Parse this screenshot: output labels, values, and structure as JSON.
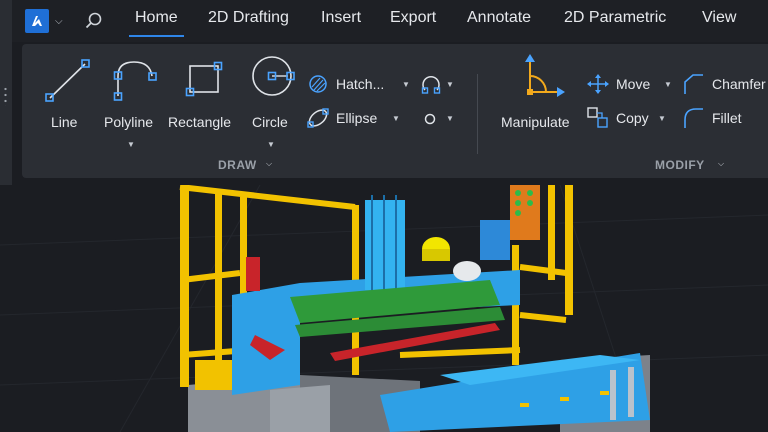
{
  "app": {
    "menu_icon": "bricscad-logo",
    "menu_chevron": "chevron-down-icon",
    "search_icon": "search-icon"
  },
  "tabs": [
    {
      "label": "Home",
      "active": true
    },
    {
      "label": "2D Drafting",
      "active": false
    },
    {
      "label": "Insert",
      "active": false
    },
    {
      "label": "Export",
      "active": false
    },
    {
      "label": "Annotate",
      "active": false
    },
    {
      "label": "2D Parametric",
      "active": false
    },
    {
      "label": "View",
      "active": false
    }
  ],
  "draw_panel": {
    "title": "DRAW",
    "tools": {
      "line": "Line",
      "polyline": "Polyline",
      "rectangle": "Rectangle",
      "circle": "Circle",
      "hatch": "Hatch...",
      "ellipse": "Ellipse"
    }
  },
  "modify_panel": {
    "title": "MODIFY",
    "tools": {
      "manipulate": "Manipulate",
      "move": "Move",
      "copy": "Copy",
      "chamfer": "Chamfer",
      "fillet": "Fillet"
    }
  },
  "colors": {
    "accent": "#2f86e9",
    "icon_blue": "#4aa3ff",
    "ribbon_bg": "#2b2e34",
    "tabbar_bg": "#1e2025",
    "viewport_bg": "#1b1d22",
    "manipulate_orange": "#f2a91c"
  },
  "viewport": {
    "content": "3d-machine-model"
  }
}
